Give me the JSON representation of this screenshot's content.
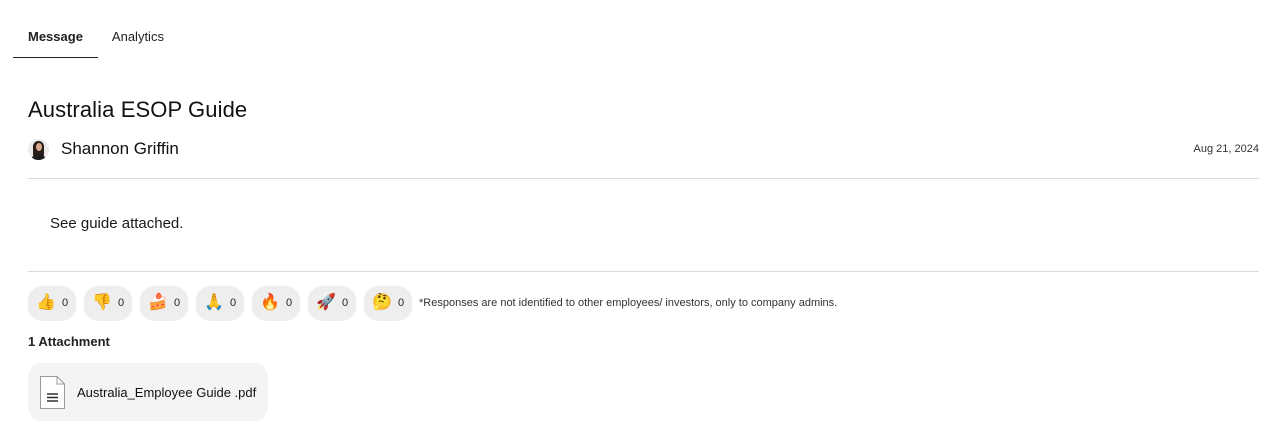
{
  "tabs": [
    {
      "label": "Message",
      "active": true
    },
    {
      "label": "Analytics",
      "active": false
    }
  ],
  "post": {
    "title": "Australia ESOP Guide",
    "author": "Shannon Griffin",
    "date": "Aug 21, 2024",
    "body": "See guide attached."
  },
  "reactions": [
    {
      "emoji": "👍",
      "icon": "thumbs-up-icon",
      "count": "0"
    },
    {
      "emoji": "👎",
      "icon": "thumbs-down-icon",
      "count": "0"
    },
    {
      "emoji": "🍰",
      "icon": "cake-icon",
      "count": "0"
    },
    {
      "emoji": "🙏",
      "icon": "praying-hands-icon",
      "count": "0"
    },
    {
      "emoji": "🔥",
      "icon": "fire-icon",
      "count": "0"
    },
    {
      "emoji": "🚀",
      "icon": "rocket-icon",
      "count": "0"
    },
    {
      "emoji": "🤔",
      "icon": "thinking-face-icon",
      "count": "0"
    }
  ],
  "reactions_note": "*Responses are not identified to other employees/ investors, only to company admins.",
  "attachments": {
    "heading": "1 Attachment",
    "items": [
      {
        "name": "Australia_Employee Guide .pdf",
        "icon": "document-icon"
      }
    ]
  },
  "colors": {
    "divider": "#d9d9d9",
    "reaction_bg": "#eeeeee",
    "attachment_bg": "#f4f4f4"
  }
}
